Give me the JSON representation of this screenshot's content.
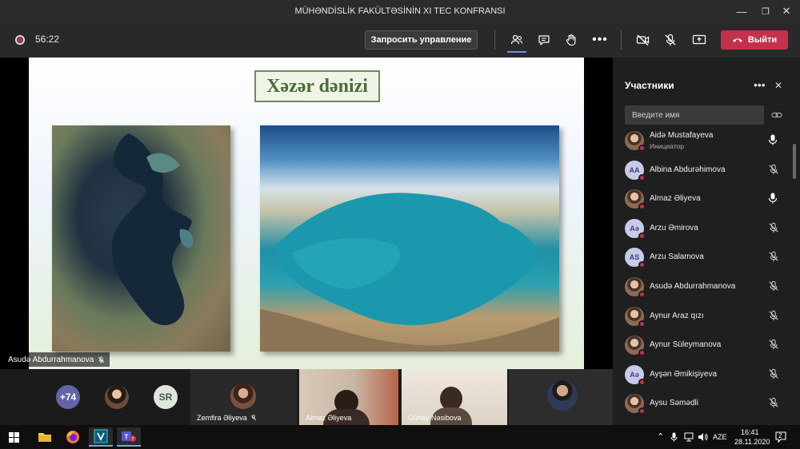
{
  "window": {
    "title": "MÜHƏNDİSLİK FAKÜLTƏSİNİN XI TEC KONFRANSI"
  },
  "meeting": {
    "timer": "56:22",
    "request_control_label": "Запросить управление",
    "leave_label": "Выйти"
  },
  "slide": {
    "title": "Xəzər dənizi",
    "presenter": "Asudə Abdurrahmanova"
  },
  "gallery": {
    "overflow_count": "+74",
    "initials_tile": "SR",
    "tiles": [
      {
        "name": "Zemfira Əliyeva"
      },
      {
        "name": "Almaz Əliyeva"
      },
      {
        "name": "Günay Nəsibova"
      }
    ]
  },
  "participants": {
    "title": "Участники",
    "search_placeholder": "Введите имя",
    "list": [
      {
        "name": "Aidə Mustafayeva",
        "role": "Инициатор",
        "initials": "",
        "photo": true,
        "mic": "on"
      },
      {
        "name": "Albina Abdurəhimova",
        "initials": "AA",
        "photo": false,
        "mic": "muted"
      },
      {
        "name": "Almaz Əliyeva",
        "initials": "",
        "photo": true,
        "mic": "on"
      },
      {
        "name": "Arzu Əmirova",
        "initials": "Aə",
        "photo": false,
        "mic": "muted"
      },
      {
        "name": "Arzu Salamova",
        "initials": "AS",
        "photo": false,
        "mic": "muted"
      },
      {
        "name": "Asudə Abdurrahmanova",
        "initials": "",
        "photo": true,
        "mic": "muted"
      },
      {
        "name": "Aynur Araz qızı",
        "initials": "",
        "photo": true,
        "mic": "muted"
      },
      {
        "name": "Aynur Süleymanova",
        "initials": "",
        "photo": true,
        "mic": "muted"
      },
      {
        "name": "Ayşən Əmikişiyeva",
        "initials": "Aə",
        "photo": false,
        "mic": "muted"
      },
      {
        "name": "Aysu Səmədli",
        "initials": "",
        "photo": true,
        "mic": "muted"
      }
    ]
  },
  "taskbar": {
    "language": "AZE",
    "time": "16:41",
    "date": "28.11.2020",
    "notification_count": "2"
  },
  "colors": {
    "leave": "#c4314b",
    "accent": "#6264a7",
    "presence_busy": "#c4314b"
  }
}
